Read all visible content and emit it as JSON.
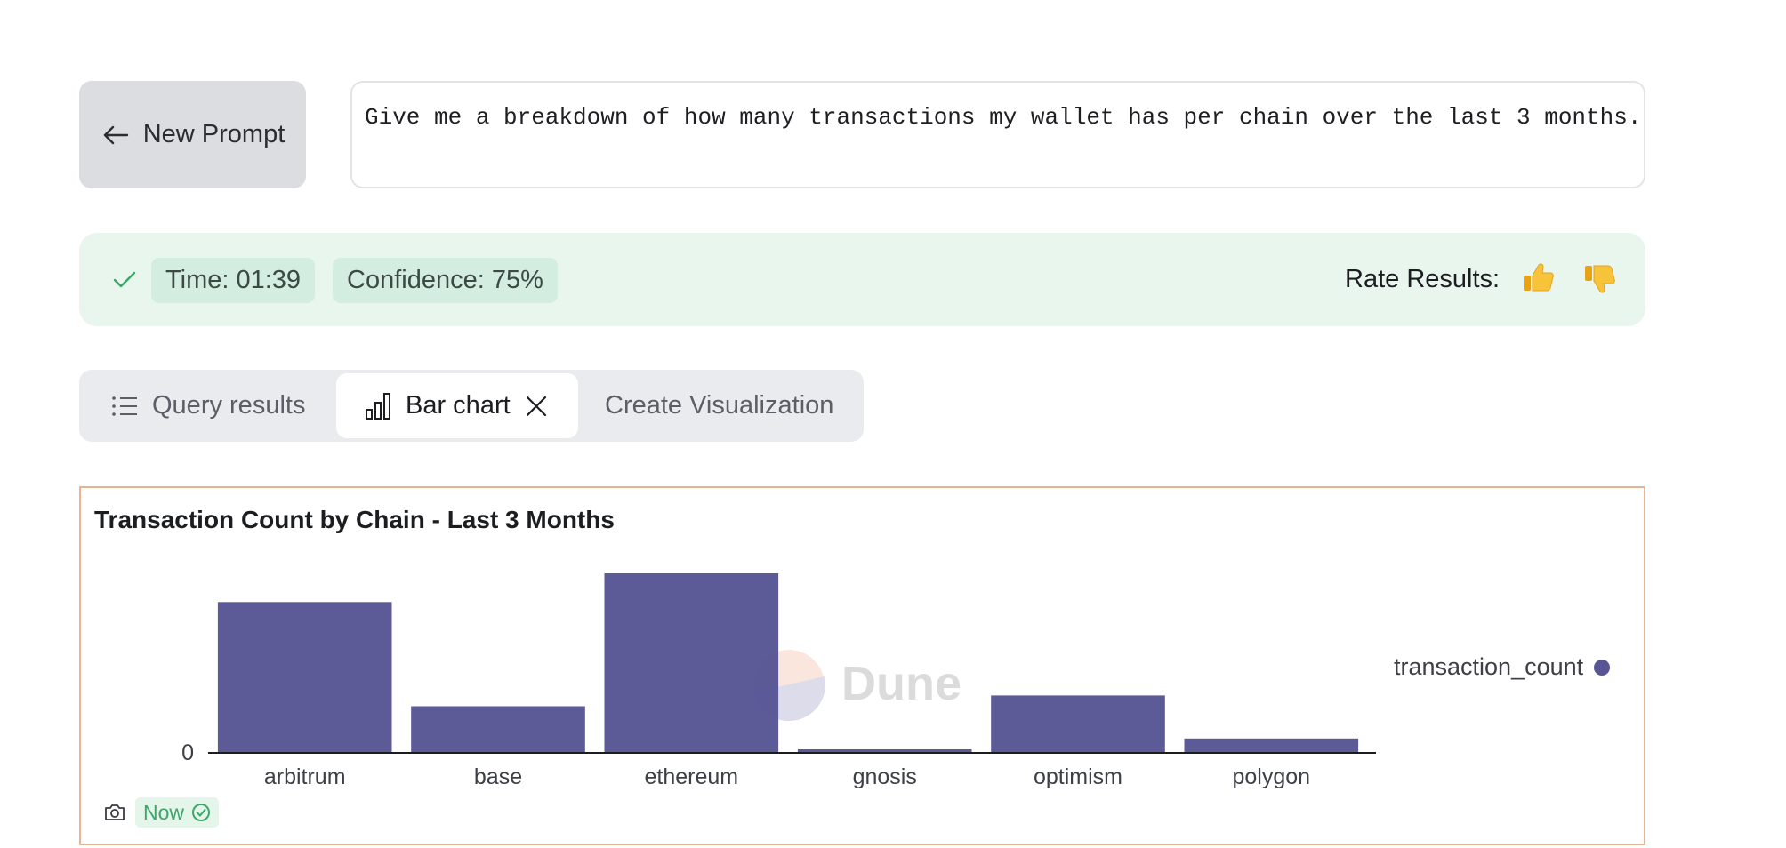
{
  "prompt": {
    "new_prompt_label": "New Prompt",
    "text": "Give me a breakdown of how many transactions my wallet has per chain over the last 3 months."
  },
  "status": {
    "time": "Time: 01:39",
    "confidence": "Confidence: 75%",
    "rate_label": "Rate Results:",
    "thumbs_up": "👍",
    "thumbs_down": "👎"
  },
  "tabs": {
    "query_results": "Query results",
    "bar_chart": "Bar chart",
    "create_visualization": "Create Visualization"
  },
  "watermark": "Dune",
  "footer": {
    "badge": "Now"
  },
  "colors": {
    "bar": "#575594",
    "status_green": "#3fa66a",
    "card_border": "#e9b494"
  },
  "chart_data": {
    "type": "bar",
    "title": "Transaction Count by Chain - Last 3 Months",
    "xlabel": "",
    "ylabel": "",
    "categories": [
      "arbitrum",
      "base",
      "ethereum",
      "gnosis",
      "optimism",
      "polygon"
    ],
    "series": [
      {
        "name": "transaction_count",
        "values": [
          84,
          26,
          100,
          2,
          32,
          8
        ]
      }
    ],
    "y_tick_labels": [
      "0"
    ],
    "ylim": [
      0,
      100
    ],
    "grid": false,
    "legend": "right"
  }
}
